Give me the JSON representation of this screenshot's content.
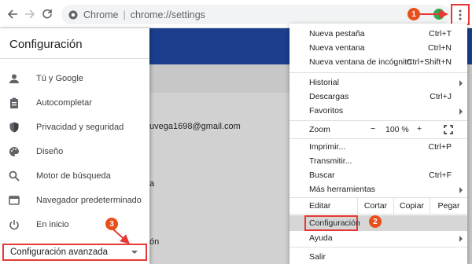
{
  "browser": {
    "site_name": "Chrome",
    "url": "chrome://settings"
  },
  "sidebar": {
    "title": "Configuración",
    "items": [
      {
        "label": "Tú y Google",
        "icon": "person-icon"
      },
      {
        "label": "Autocompletar",
        "icon": "clipboard-icon"
      },
      {
        "label": "Privacidad y seguridad",
        "icon": "shield-icon"
      },
      {
        "label": "Diseño",
        "icon": "palette-icon"
      },
      {
        "label": "Motor de búsqueda",
        "icon": "search-icon"
      },
      {
        "label": "Navegador predeterminado",
        "icon": "browser-window-icon"
      },
      {
        "label": "En inicio",
        "icon": "power-icon"
      }
    ],
    "advanced": "Configuración avanzada"
  },
  "background": {
    "email_fragment": "uvega1698@gmail.com",
    "fragment_1": "a",
    "fragment_2": "ón"
  },
  "menu": {
    "new_tab": {
      "label": "Nueva pestaña",
      "shortcut": "Ctrl+T"
    },
    "new_window": {
      "label": "Nueva ventana",
      "shortcut": "Ctrl+N"
    },
    "incognito": {
      "label": "Nueva ventana de incógnito",
      "shortcut": "Ctrl+Shift+N"
    },
    "history": {
      "label": "Historial"
    },
    "downloads": {
      "label": "Descargas",
      "shortcut": "Ctrl+J"
    },
    "bookmarks": {
      "label": "Favoritos"
    },
    "zoom": {
      "label": "Zoom",
      "minus": "−",
      "value": "100 %",
      "plus": "+"
    },
    "print": {
      "label": "Imprimir...",
      "shortcut": "Ctrl+P"
    },
    "cast": {
      "label": "Transmitir..."
    },
    "find": {
      "label": "Buscar",
      "shortcut": "Ctrl+F"
    },
    "more_tools": {
      "label": "Más herramientas"
    },
    "edit": {
      "label": "Editar",
      "cut": "Cortar",
      "copy": "Copiar",
      "paste": "Pegar"
    },
    "settings": {
      "label": "Configuración"
    },
    "help": {
      "label": "Ayuda"
    },
    "exit": {
      "label": "Salir"
    }
  },
  "steps": {
    "one": "1",
    "two": "2",
    "three": "3"
  },
  "colors": {
    "accent_red": "#e53935",
    "step_orange": "#e8501a",
    "header_blue": "#1a3e8c"
  }
}
